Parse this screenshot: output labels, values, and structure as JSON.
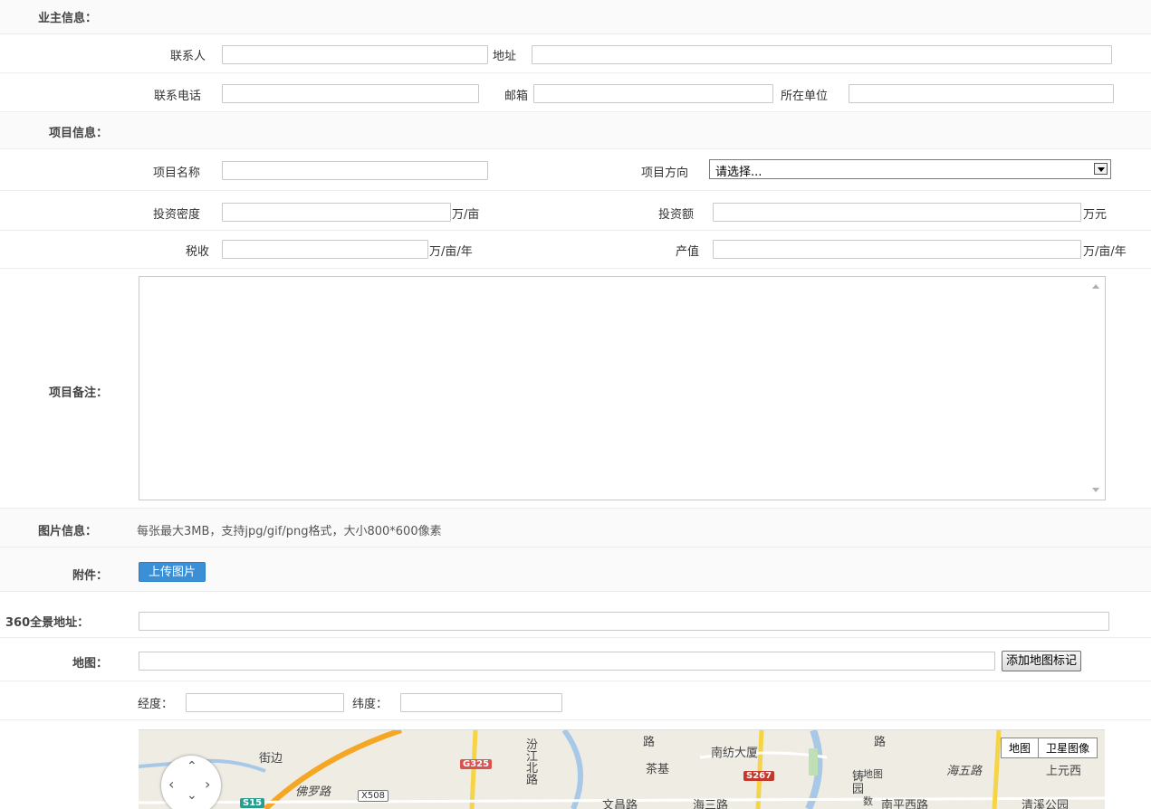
{
  "owner_section": {
    "title": "业主信息：",
    "contact_label": "联系人",
    "address_label": "地址",
    "phone_label": "联系电话",
    "email_label": "邮箱",
    "company_label": "所在单位"
  },
  "project_section": {
    "title": "项目信息：",
    "name_label": "项目名称",
    "direction_label": "项目方向",
    "direction_selected": "请选择...",
    "density_label": "投资密度",
    "density_unit": "万/亩",
    "investment_label": "投资额",
    "investment_unit": "万元",
    "tax_label": "税收",
    "tax_unit": "万/亩/年",
    "output_label": "产值",
    "output_unit": "万/亩/年"
  },
  "remarks": {
    "label": "项目备注："
  },
  "image_info": {
    "label": "图片信息：",
    "hint": "每张最大3MB，支持jpg/gif/png格式，大小800*600像素"
  },
  "attachment": {
    "label": "附件：",
    "upload_button": "上传图片"
  },
  "panorama": {
    "label": "360全景地址："
  },
  "map_field": {
    "label": "地图：",
    "add_marker_button": "添加地图标记",
    "longitude_label": "经度：",
    "latitude_label": "纬度："
  },
  "map": {
    "type_map": "地图",
    "type_satellite": "卫星图像",
    "places": [
      "街边",
      "佛罗路",
      "汾江北路",
      "茶基",
      "南纺大厦",
      "文昌路",
      "海三路",
      "海五路",
      "上元西",
      "南平西路",
      "清溪公园",
      "路",
      "铸",
      "园",
      "路",
      "地图",
      "数"
    ],
    "road_shields": [
      "G325",
      "S267",
      "S15",
      "X508"
    ]
  }
}
